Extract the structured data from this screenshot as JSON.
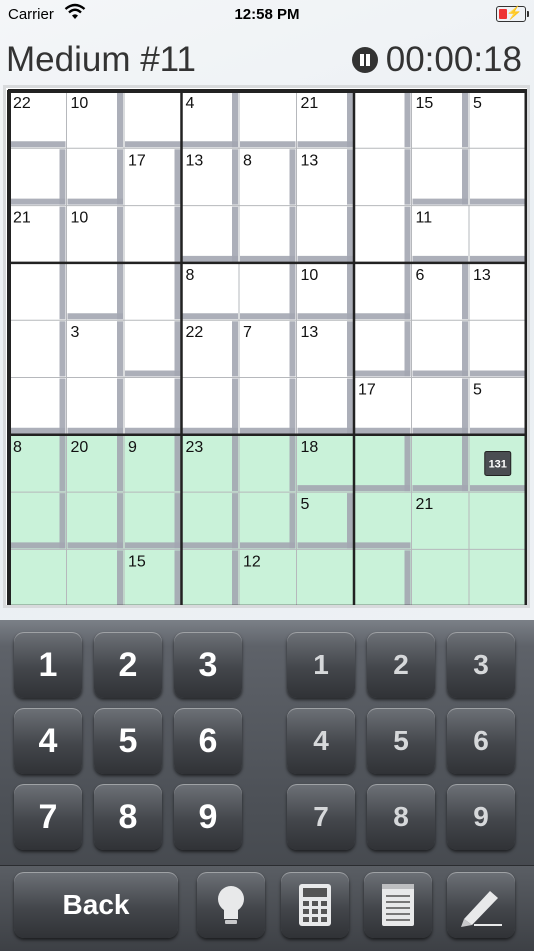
{
  "status": {
    "carrier": "Carrier",
    "time": "12:58 PM"
  },
  "header": {
    "title": "Medium #11",
    "timer": "00:00:18"
  },
  "board": {
    "colors": {
      "white": "#ffffff",
      "green": "#c9f2d9",
      "cage": "#a4a7b2",
      "thin": "#b6b8bc",
      "thick": "#222222"
    },
    "regions": [
      "AABBCCDEF",
      "GAHIJKDEF",
      "LMHIJKDNN",
      "LMHOOPDQR",
      "LSHTUVWQR",
      "LSXTUVYYZ",
      "abcdeffgh",
      "abcdeijjj",
      "kklmnnnjj"
    ],
    "green_rows_from": 6,
    "clues": [
      {
        "r": 0,
        "c": 0,
        "v": "22"
      },
      {
        "r": 0,
        "c": 1,
        "v": "10"
      },
      {
        "r": 0,
        "c": 3,
        "v": "4"
      },
      {
        "r": 0,
        "c": 5,
        "v": "21"
      },
      {
        "r": 0,
        "c": 7,
        "v": "15"
      },
      {
        "r": 0,
        "c": 8,
        "v": "5"
      },
      {
        "r": 1,
        "c": 2,
        "v": "17"
      },
      {
        "r": 1,
        "c": 3,
        "v": "13"
      },
      {
        "r": 1,
        "c": 4,
        "v": "8"
      },
      {
        "r": 1,
        "c": 5,
        "v": "13"
      },
      {
        "r": 2,
        "c": 0,
        "v": "21"
      },
      {
        "r": 2,
        "c": 1,
        "v": "10"
      },
      {
        "r": 2,
        "c": 7,
        "v": "11"
      },
      {
        "r": 3,
        "c": 3,
        "v": "8"
      },
      {
        "r": 3,
        "c": 5,
        "v": "10"
      },
      {
        "r": 3,
        "c": 7,
        "v": "6"
      },
      {
        "r": 3,
        "c": 8,
        "v": "13"
      },
      {
        "r": 4,
        "c": 1,
        "v": "3"
      },
      {
        "r": 4,
        "c": 3,
        "v": "22"
      },
      {
        "r": 4,
        "c": 4,
        "v": "7"
      },
      {
        "r": 4,
        "c": 5,
        "v": "13"
      },
      {
        "r": 5,
        "c": 6,
        "v": "17"
      },
      {
        "r": 5,
        "c": 8,
        "v": "5"
      },
      {
        "r": 6,
        "c": 0,
        "v": "8"
      },
      {
        "r": 6,
        "c": 1,
        "v": "20"
      },
      {
        "r": 6,
        "c": 2,
        "v": "9"
      },
      {
        "r": 6,
        "c": 3,
        "v": "23"
      },
      {
        "r": 6,
        "c": 5,
        "v": "18"
      },
      {
        "r": 7,
        "c": 5,
        "v": "5"
      },
      {
        "r": 7,
        "c": 7,
        "v": "21"
      },
      {
        "r": 8,
        "c": 2,
        "v": "15"
      },
      {
        "r": 8,
        "c": 4,
        "v": "12"
      }
    ],
    "badge": {
      "r": 6,
      "c": 8,
      "v": "131"
    }
  },
  "keypad": {
    "big": [
      "1",
      "2",
      "3",
      "4",
      "5",
      "6",
      "7",
      "8",
      "9"
    ],
    "small": [
      "1",
      "2",
      "3",
      "4",
      "5",
      "6",
      "7",
      "8",
      "9"
    ]
  },
  "toolbar": {
    "back_label": "Back",
    "icons": [
      "lightbulb-icon",
      "calculator-icon",
      "notepad-icon",
      "pencil-icon"
    ]
  }
}
